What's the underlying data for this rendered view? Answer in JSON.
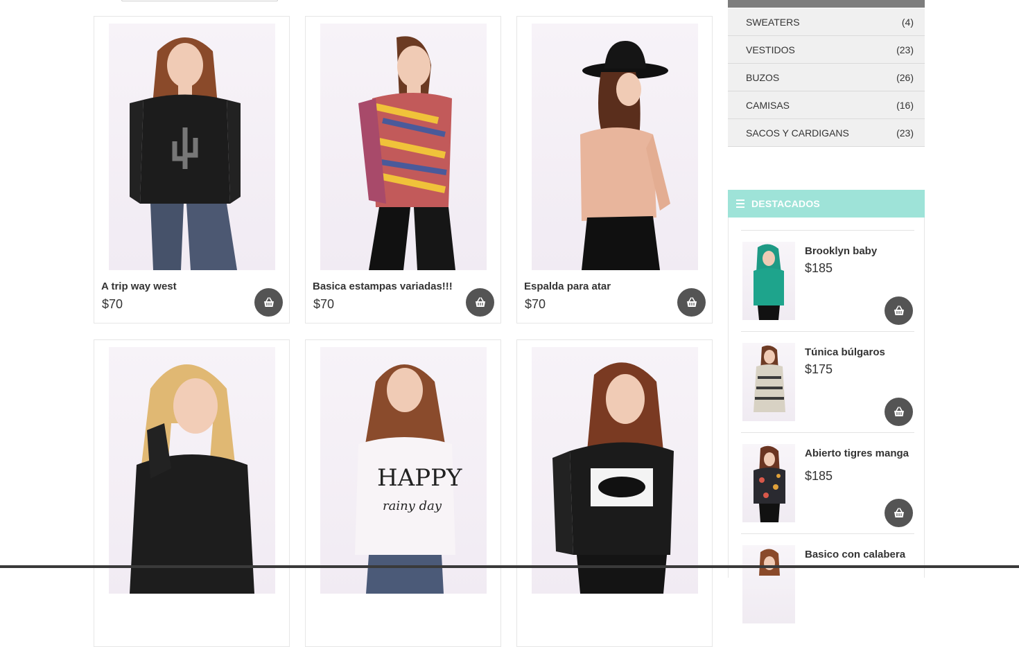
{
  "products": [
    {
      "name": "A trip way west",
      "price": "$70"
    },
    {
      "name": "Basica estampas variadas!!!",
      "price": "$70"
    },
    {
      "name": "Espalda para atar",
      "price": "$70"
    },
    {
      "name": "",
      "price": ""
    },
    {
      "name": "",
      "price": ""
    },
    {
      "name": "",
      "price": ""
    }
  ],
  "categories": [
    {
      "label": "SWEATERS",
      "count": "(4)"
    },
    {
      "label": "VESTIDOS",
      "count": "(23)"
    },
    {
      "label": "BUZOS",
      "count": "(26)"
    },
    {
      "label": "CAMISAS",
      "count": "(16)"
    },
    {
      "label": "SACOS Y CARDIGANS",
      "count": "(23)"
    }
  ],
  "featured": {
    "title": "DESTACADOS",
    "items": [
      {
        "name": "Brooklyn baby",
        "price": "$185"
      },
      {
        "name": "Túnica búlgaros",
        "price": "$175"
      },
      {
        "name": "Abierto tigres manga",
        "price": "$185"
      },
      {
        "name": "Basico con calabera",
        "price": ""
      }
    ]
  },
  "icons": {
    "cart": "shopping-basket-icon",
    "menu": "menu-lines-icon"
  },
  "colors": {
    "accent": "#9ee3d8",
    "button": "#545454",
    "category_bg": "#f0f0f0"
  }
}
